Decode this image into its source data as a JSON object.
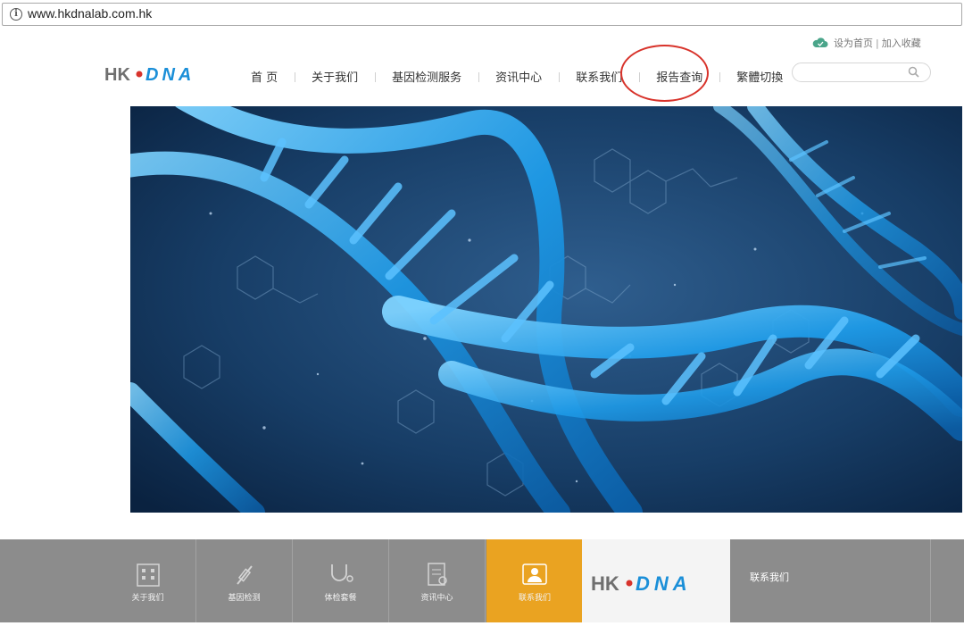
{
  "browser": {
    "url": "www.hkdnalab.com.hk"
  },
  "header": {
    "toplinks": {
      "set_home": "设为首页",
      "separator": "|",
      "favorite": "加入收藏"
    },
    "logo": {
      "part1": "HK",
      "part2": "DNA",
      "color_gray": "#6f6f6f",
      "color_blue": "#1b8fd8"
    },
    "nav": [
      {
        "label": "首 页"
      },
      {
        "label": "关于我们"
      },
      {
        "label": "基因检测服务"
      },
      {
        "label": "资讯中心"
      },
      {
        "label": "联系我们"
      },
      {
        "label": "报告查询",
        "highlighted": true,
        "highlight_color": "#d8332b"
      },
      {
        "label": "繁體切換"
      }
    ],
    "search": {
      "placeholder": "",
      "icon": "search-icon"
    }
  },
  "hero": {
    "description_icon": "dna-helix-image",
    "background_color": "#0e2a4d",
    "accent_color": "#1e9be8"
  },
  "footer": {
    "tiles": [
      {
        "label": "关于我们",
        "icon": "building-icon"
      },
      {
        "label": "基因检测",
        "icon": "syringe-icon"
      },
      {
        "label": "体检套餐",
        "icon": "stethoscope-icon"
      },
      {
        "label": "资讯中心",
        "icon": "document-icon"
      },
      {
        "label": "联系我们",
        "icon": "contact-person-icon",
        "active": true,
        "active_color": "#eaa321"
      }
    ],
    "contact_title": "联系我们",
    "background_color": "#8c8c8c"
  }
}
